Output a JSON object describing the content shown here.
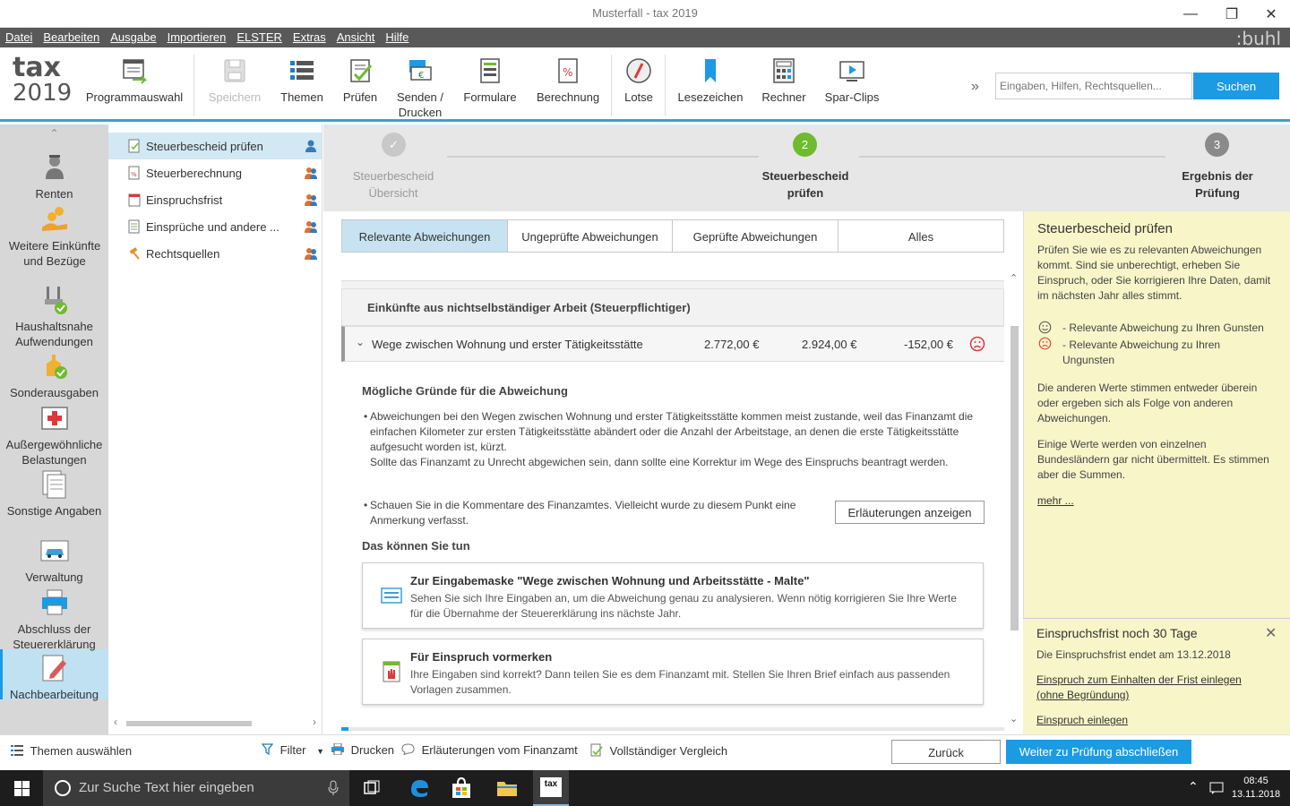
{
  "window": {
    "title": "Musterfall - tax 2019"
  },
  "menu": [
    "Datei",
    "Bearbeiten",
    "Ausgabe",
    "Importieren",
    "ELSTER",
    "Extras",
    "Ansicht",
    "Hilfe"
  ],
  "brand": ":buhl",
  "logo": {
    "line1": "tax",
    "line2": "2019"
  },
  "toolbar": {
    "programmauswahl": "Programmauswahl",
    "speichern": "Speichern",
    "themen": "Themen",
    "pruefen": "Prüfen",
    "senden1": "Senden /",
    "senden2": "Drucken",
    "formulare": "Formulare",
    "berechnung": "Berechnung",
    "lotse": "Lotse",
    "lesezeichen": "Lesezeichen",
    "rechner": "Rechner",
    "sparclips": "Spar-Clips",
    "more": "»"
  },
  "search": {
    "placeholder": "Eingaben, Hilfen, Rechtsquellen...",
    "button": "Suchen"
  },
  "leftnav": [
    {
      "label": "Renten"
    },
    {
      "label": "Weitere Einkünfte und Bezüge"
    },
    {
      "label": "Haushaltsnahe Aufwendungen"
    },
    {
      "label": "Sonderausgaben"
    },
    {
      "label": "Außergewöhnliche Belastungen"
    },
    {
      "label": "Sonstige Angaben"
    },
    {
      "label": "Verwaltung"
    },
    {
      "label": "Abschluss der Steuererklärung"
    },
    {
      "label": "Nachbearbeitung"
    }
  ],
  "subnav": [
    {
      "label": "Steuerbescheid prüfen"
    },
    {
      "label": "Steuerberechnung"
    },
    {
      "label": "Einspruchsfrist"
    },
    {
      "label": "Einsprüche und andere ..."
    },
    {
      "label": "Rechtsquellen"
    }
  ],
  "steps": [
    {
      "num": "✓",
      "line1": "Steuerbescheid",
      "line2": "Übersicht"
    },
    {
      "num": "2",
      "line1": "Steuerbescheid",
      "line2": "prüfen"
    },
    {
      "num": "3",
      "line1": "Ergebnis der",
      "line2": "Prüfung"
    }
  ],
  "tabs": [
    "Relevante Abweichungen",
    "Ungeprüfte Abweichungen",
    "Geprüfte Abweichungen",
    "Alles"
  ],
  "section": {
    "title": "Einkünfte aus nichtselbständiger Arbeit (Steuerpflichtiger)"
  },
  "row": {
    "label": "Wege zwischen Wohnung und erster Tätigkeitsstätte",
    "v1": "2.772,00 €",
    "v2": "2.924,00 €",
    "diff": "-152,00 €"
  },
  "detail": {
    "heading": "Mögliche Gründe für die Abweichung",
    "p1": "Abweichungen bei den Wegen zwischen Wohnung und erster Tätigkeitsstätte kommen meist zustande, weil das Finanzamt die einfachen Kilometer zur ersten Tätigkeitsstätte abändert oder die Anzahl der Arbeitstage, an denen die erste Tätigkeitsstätte aufgesucht worden ist, kürzt.",
    "p1b": "Sollte das Finanzamt zu Unrecht abgewichen sein, dann sollte eine Korrektur im Wege des Einspruchs beantragt werden.",
    "p2": "Schauen Sie in die Kommentare des Finanzamtes. Vielleicht wurde zu diesem Punkt eine Anmerkung verfasst.",
    "button": "Erläuterungen anzeigen",
    "todo": "Das können Sie tun",
    "card1_title": "Zur Eingabemaske \"Wege zwischen Wohnung und Arbeitsstätte - Malte\"",
    "card1_desc": "Sehen Sie sich Ihre Eingaben an, um die Abweichung genau zu analysieren. Wenn nötig korrigieren Sie Ihre Werte für die Übernahme der Steuererklärung ins nächste Jahr.",
    "card2_title": "Für Einspruch vormerken",
    "card2_desc": "Ihre Eingaben sind korrekt? Dann teilen Sie es dem Finanzamt mit. Stellen Sie Ihren Brief einfach aus passenden Vorlagen zusammen."
  },
  "rightpane": {
    "title": "Steuerbescheid prüfen",
    "p1": "Prüfen Sie wie es zu relevanten Abweichungen kommt. Sind sie unberechtigt, erheben Sie Einspruch, oder Sie korrigieren Ihre Daten, damit im nächsten Jahr alles stimmt.",
    "legend_good": "- Relevante Abweichung zu Ihren Gunsten",
    "legend_bad": "- Relevante Abweichung zu Ihren Ungunsten",
    "p2": "Die anderen Werte stimmen entweder überein oder ergeben sich als Folge von anderen Abweichungen.",
    "p3": "Einige Werte werden von einzelnen Bundesländern gar nicht übermittelt. Es stimmen aber die Summen.",
    "more": "mehr ...",
    "frist_title": "Einspruchsfrist noch 30 Tage",
    "frist_text": "Die Einspruchsfrist endet am 13.12.2018",
    "frist_link1": "Einspruch zum Einhalten der Frist einlegen (ohne Begründung)",
    "frist_link2": "Einspruch einlegen"
  },
  "bottom": {
    "themen": "Themen auswählen",
    "filter": "Filter",
    "drucken": "Drucken",
    "erlaeuterungen": "Erläuterungen vom Finanzamt",
    "vergleich": "Vollständiger Vergleich",
    "zurueck": "Zurück",
    "weiter": "Weiter zu Prüfung abschließen"
  },
  "taskbar": {
    "search": "Zur Suche Text hier eingeben",
    "time": "08:45",
    "date": "13.11.2018",
    "app": "tax"
  },
  "colors": {
    "accent": "#1c9be2",
    "step_active": "#6dbb2e",
    "step_done": "#c8c8c8",
    "warn": "#d93a3a"
  }
}
